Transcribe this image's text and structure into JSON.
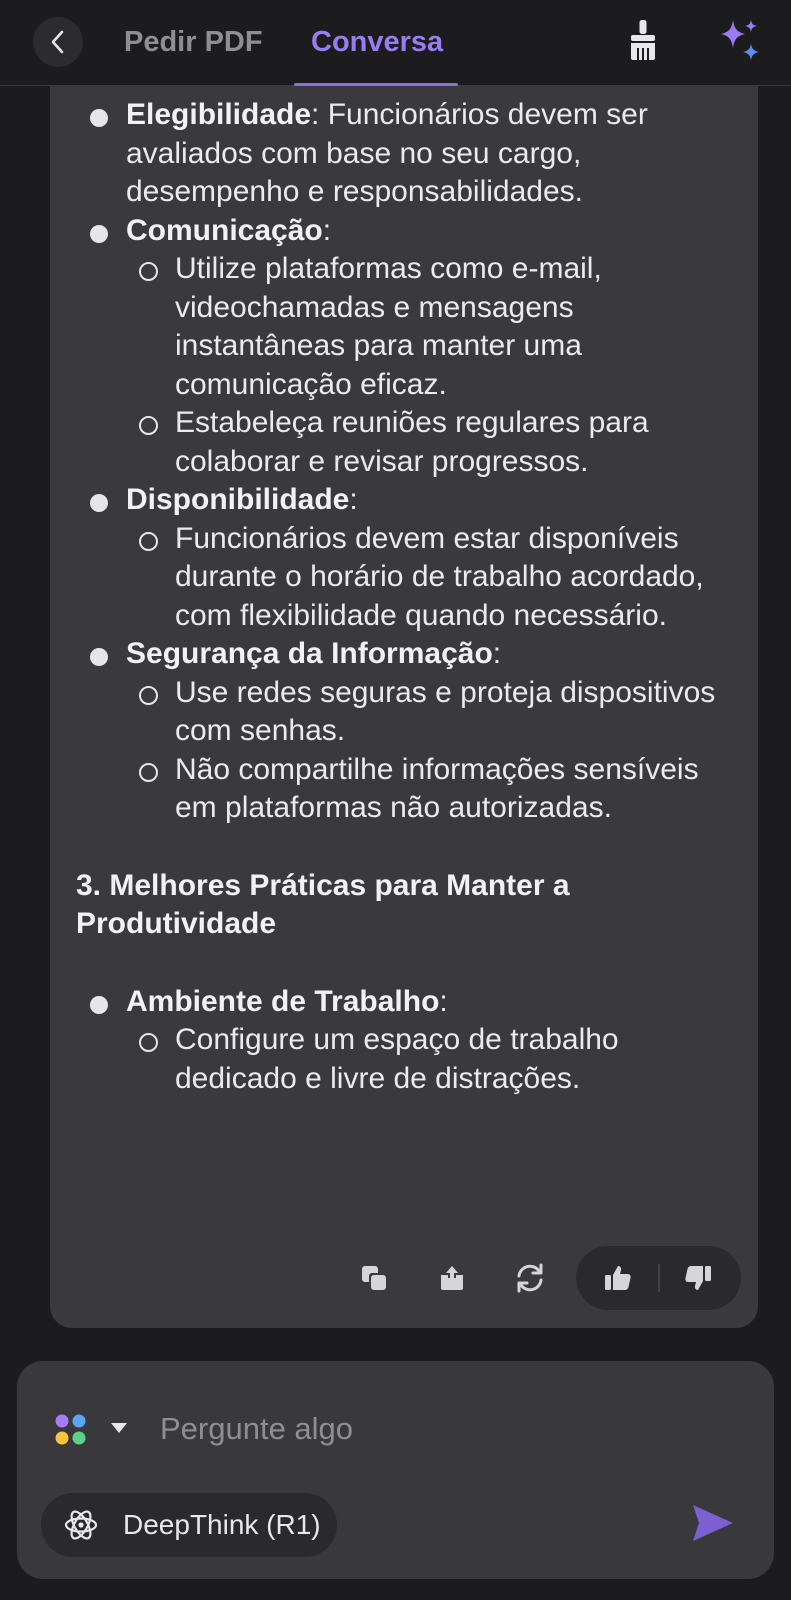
{
  "header": {
    "tabs": [
      {
        "label": "Pedir PDF",
        "active": false
      },
      {
        "label": "Conversa",
        "active": true
      }
    ]
  },
  "message": {
    "items": [
      {
        "term": "Elegibilidade",
        "text": ": Funcionários devem ser avaliados com base no seu cargo, desempenho e responsabilidades.",
        "subs": []
      },
      {
        "term": "Comunicação",
        "text": ":",
        "subs": [
          "Utilize plataformas como e-mail, videochamadas e mensagens instantâneas para manter uma comunicação eficaz.",
          "Estabeleça reuniões regulares para colaborar e revisar progressos."
        ]
      },
      {
        "term": "Disponibilidade",
        "text": ":",
        "subs": [
          "Funcionários devem estar disponíveis durante o horário de trabalho acordado, com flexibilidade quando necessário."
        ]
      },
      {
        "term": "Segurança da Informação",
        "text": ":",
        "subs": [
          "Use redes seguras e proteja dispositivos com senhas.",
          "Não compartilhe informações sensíveis em plataformas não autorizadas."
        ]
      }
    ],
    "heading": "3. Melhores Práticas para Manter a Produtividade",
    "items2": [
      {
        "term": "Ambiente de Trabalho",
        "text": ":",
        "subs": [
          "Configure um espaço de trabalho dedicado e livre de distrações."
        ]
      }
    ]
  },
  "composer": {
    "placeholder": "Pergunte algo",
    "deepthink_label": "DeepThink (R1)"
  },
  "colors": {
    "accent": "#9b7bf2",
    "background": "#1c1c1e",
    "card": "#3a3a3d"
  }
}
